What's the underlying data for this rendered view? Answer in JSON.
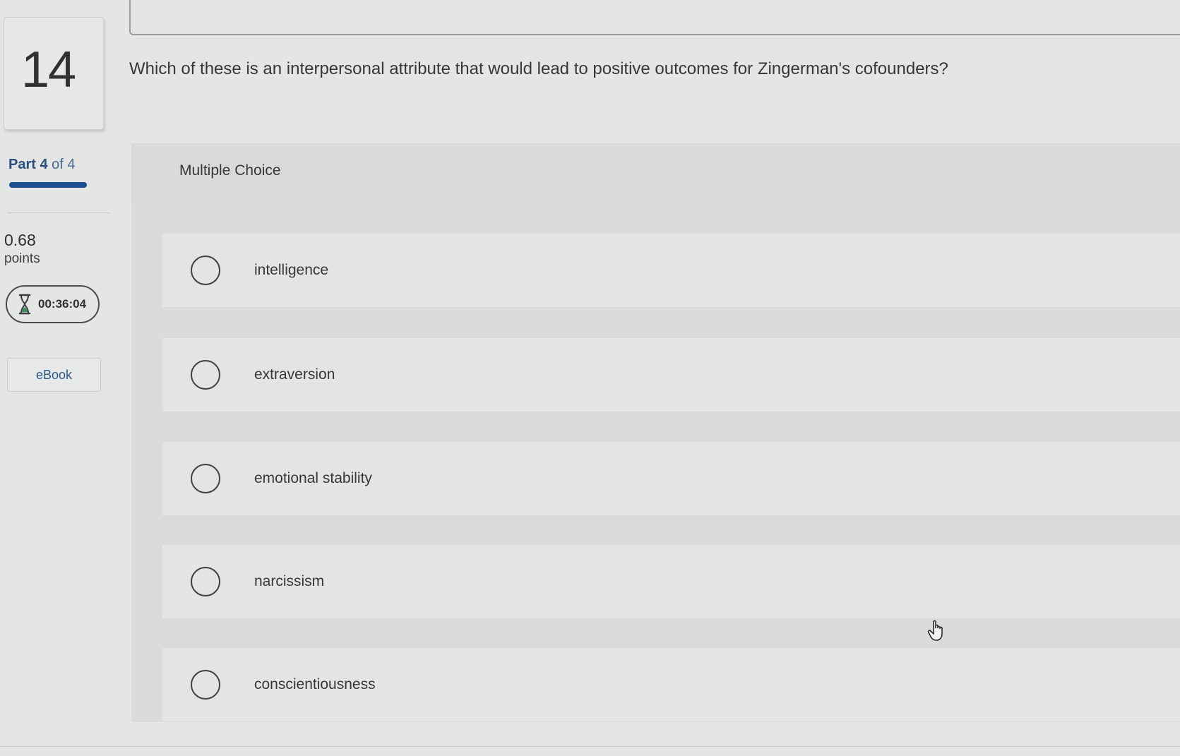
{
  "question": {
    "number": "14",
    "text": "Which of these is an interpersonal attribute that would lead to positive outcomes for Zingerman's cofounders?"
  },
  "sidebar": {
    "part_word": "Part",
    "part_current": "4",
    "part_of_text": "of 4",
    "progress_fraction": 1.0,
    "points_value": "0.68",
    "points_label": "points",
    "timer_icon": "hourglass-icon",
    "timer_text": "00:36:04",
    "ebook_label": "eBook"
  },
  "multiple_choice": {
    "title": "Multiple Choice",
    "options": [
      {
        "label": "intelligence",
        "selected": false
      },
      {
        "label": "extraversion",
        "selected": false
      },
      {
        "label": "emotional stability",
        "selected": false
      },
      {
        "label": "narcissism",
        "selected": false
      },
      {
        "label": "conscientiousness",
        "selected": false
      }
    ]
  },
  "colors": {
    "accent": "#1a4f8f",
    "link": "#2e5a8e",
    "background": "#e4e5e5"
  }
}
